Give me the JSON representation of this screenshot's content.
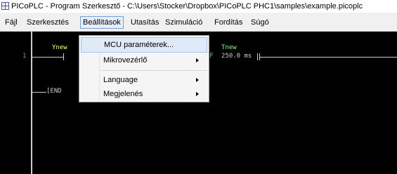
{
  "window": {
    "title": "PICoPLC - Program Szerkesztő - C:\\Users\\Stocker\\Dropbox\\PICoPLC PHC1\\samples\\example.picoplc",
    "icon": "ladder-app-icon"
  },
  "menubar": {
    "items": [
      {
        "label": "Fájl"
      },
      {
        "label": "Szerkesztés"
      },
      {
        "label": "Beállítások",
        "active": true
      },
      {
        "label": "Utasítás"
      },
      {
        "label": "Szimuláció"
      },
      {
        "label": "Fordítás"
      },
      {
        "label": "Súgó"
      }
    ]
  },
  "dropdown": {
    "items": [
      {
        "label": "MCU paraméterek...",
        "submenu": false,
        "highlighted": true
      },
      {
        "label": "Mikrovezérlő",
        "submenu": true
      },
      {
        "label": "Language",
        "submenu": true
      },
      {
        "label": "Megjelenés",
        "submenu": true
      }
    ]
  },
  "ladder": {
    "rung_number": "1",
    "contact_name": "Ynew",
    "timer_name": "Tnew",
    "timer_value": "250.0 ms",
    "timer_prefix": "F",
    "end_label": "[END",
    "colors": {
      "rail": "#cccccc",
      "label": "#ffff80",
      "timer": "#80ff80",
      "rung_number": "#c08040"
    }
  }
}
